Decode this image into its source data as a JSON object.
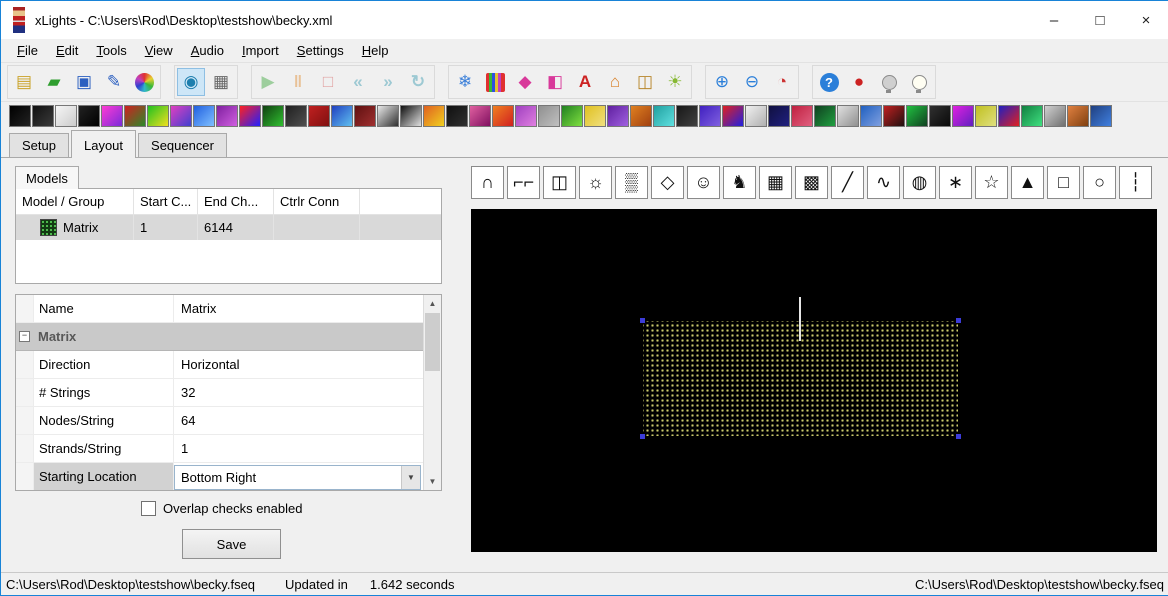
{
  "window": {
    "title": "xLights - C:\\Users\\Rod\\Desktop\\testshow\\becky.xml",
    "controls": {
      "minimize": "–",
      "maximize": "□",
      "close": "×"
    }
  },
  "menu": {
    "items": [
      "File",
      "Edit",
      "Tools",
      "View",
      "Audio",
      "Import",
      "Settings",
      "Help"
    ]
  },
  "icons": {
    "scroll_up": "▲",
    "scroll_down": "▼",
    "dropdown": "▼",
    "collapse": "−"
  },
  "toolbar": {
    "groups": [
      [
        {
          "name": "new-sequence-icon",
          "glyph": "▤",
          "fg": "#c9a227"
        },
        {
          "name": "open-sequence-icon",
          "glyph": "▰",
          "fg": "#2f9e2f"
        },
        {
          "name": "save-icon",
          "glyph": "▣",
          "fg": "#2b5fc0"
        },
        {
          "name": "save-as-icon",
          "glyph": "✎",
          "fg": "#2b5fc0"
        },
        {
          "name": "palette-icon",
          "css": "i-palette"
        }
      ],
      [
        {
          "name": "pause-render-icon",
          "glyph": "◉",
          "fg": "#1d7fae",
          "pressed": true
        },
        {
          "name": "scheduler-icon",
          "glyph": "▦",
          "fg": "#666666"
        }
      ],
      [
        {
          "name": "play-icon",
          "glyph": "▶",
          "fg": "#3aa63a",
          "disabled": true
        },
        {
          "name": "pause-icon",
          "glyph": "‖",
          "fg": "#e08a2c",
          "disabled": true,
          "bold": true
        },
        {
          "name": "stop-icon",
          "glyph": "□",
          "fg": "#d04040",
          "disabled": true,
          "bold": true
        },
        {
          "name": "rewind-icon",
          "glyph": "«",
          "fg": "#3a9ab0",
          "disabled": true,
          "bold": true
        },
        {
          "name": "go-to-end-icon",
          "glyph": "»",
          "fg": "#3a9ab0",
          "disabled": true,
          "bold": true
        },
        {
          "name": "replay-icon",
          "glyph": "↻",
          "fg": "#3a9ab0",
          "disabled": true,
          "bold": true
        }
      ],
      [
        {
          "name": "snowflake-icon",
          "glyph": "❄",
          "fg": "#3a7fd9"
        },
        {
          "name": "light-strings-icon",
          "css": "i-strings"
        },
        {
          "name": "effect-settings-icon",
          "glyph": "◆",
          "fg": "#d8399a"
        },
        {
          "name": "effect-assist-icon",
          "glyph": "◧",
          "fg": "#d8399a"
        },
        {
          "name": "font-icon",
          "glyph": "A",
          "fg": "#cc2222",
          "bold": true
        },
        {
          "name": "house-preview-icon",
          "glyph": "⌂",
          "fg": "#d9822b",
          "bold": true
        },
        {
          "name": "model-box-icon",
          "glyph": "◫",
          "fg": "#b8862b"
        },
        {
          "name": "sun-icon",
          "glyph": "☀",
          "fg": "#86b832"
        }
      ],
      [
        {
          "name": "zoom-in-icon",
          "glyph": "⊕",
          "fg": "#2b7fd9"
        },
        {
          "name": "zoom-out-icon",
          "glyph": "⊖",
          "fg": "#2b7fd9"
        },
        {
          "name": "render-all-icon",
          "glyph": "◔",
          "fg": "#cc3333"
        }
      ],
      [
        {
          "name": "help-icon",
          "css": "i-help",
          "glyph": "?"
        },
        {
          "name": "stop-now-icon",
          "glyph": "●",
          "fg": "#cc2222"
        },
        {
          "name": "lights-off-icon",
          "css": "i-bulb"
        },
        {
          "name": "lights-on-icon",
          "css": "i-bulb on"
        }
      ]
    ]
  },
  "effects_strip": {
    "icons": [
      [
        "#000000",
        "#222222"
      ],
      [
        "#111111",
        "#3a3a3a"
      ],
      [
        "#f5f5f5",
        "#cccccc"
      ],
      [
        "#222222",
        "#000000"
      ],
      [
        "#ff3bd4",
        "#7a2bd9"
      ],
      [
        "#d02020",
        "#2a8a2a"
      ],
      [
        "#20c020",
        "#f0e020"
      ],
      [
        "#e040c0",
        "#4040d0"
      ],
      [
        "#2060e0",
        "#80c0ff"
      ],
      [
        "#8020a0",
        "#d060e0"
      ],
      [
        "#ff2020",
        "#2020ff"
      ],
      [
        "#104010",
        "#30c030"
      ],
      [
        "#202020",
        "#505050"
      ],
      [
        "#c02020",
        "#801010"
      ],
      [
        "#2040c0",
        "#60c0f0"
      ],
      [
        "#601010",
        "#a03030"
      ],
      [
        "#e8e8e8",
        "#303030"
      ],
      [
        "#101010",
        "#e0e0e0"
      ],
      [
        "#e06020",
        "#f0d020"
      ],
      [
        "#101010",
        "#303030"
      ],
      [
        "#e060a0",
        "#801060"
      ],
      [
        "#f08020",
        "#d02020"
      ],
      [
        "#a040c0",
        "#e080e0"
      ],
      [
        "#909090",
        "#c0c0c0"
      ],
      [
        "#208020",
        "#80e040"
      ],
      [
        "#e0c020",
        "#f0e080"
      ],
      [
        "#6020a0",
        "#a060e0"
      ],
      [
        "#e08020",
        "#a04010"
      ],
      [
        "#20a0a0",
        "#60e0e0"
      ],
      [
        "#181818",
        "#404040"
      ],
      [
        "#4020c0",
        "#8060e0"
      ],
      [
        "#e02020",
        "#2020e0"
      ],
      [
        "#f0f0f0",
        "#b0b0b0"
      ],
      [
        "#101040",
        "#202080"
      ],
      [
        "#c02040",
        "#e06080"
      ],
      [
        "#104020",
        "#20a040"
      ],
      [
        "#e0e0e0",
        "#909090"
      ],
      [
        "#2060c0",
        "#80a0e0"
      ],
      [
        "#c02020",
        "#201010"
      ],
      [
        "#20c040",
        "#104020"
      ],
      [
        "#303030",
        "#0a0a0a"
      ],
      [
        "#e020e0",
        "#6020c0"
      ],
      [
        "#c0c020",
        "#e0e080"
      ],
      [
        "#2020c0",
        "#e02020"
      ],
      [
        "#108040",
        "#40e080"
      ],
      [
        "#d0d0d0",
        "#707070"
      ],
      [
        "#e08040",
        "#804010"
      ],
      [
        "#204080",
        "#4080e0"
      ]
    ]
  },
  "tabs": {
    "items": [
      "Setup",
      "Layout",
      "Sequencer"
    ],
    "active": "Layout"
  },
  "models_panel": {
    "title": "Models",
    "columns": [
      "Model / Group",
      "Start C...",
      "End Ch...",
      "Ctrlr Conn"
    ],
    "rows": [
      {
        "name": "Matrix",
        "start": "1",
        "end": "6144",
        "ctrlr": ""
      }
    ]
  },
  "properties": {
    "rows": [
      {
        "label": "Name",
        "value": "Matrix",
        "kind": "text"
      },
      {
        "label": "Matrix",
        "value": "",
        "kind": "category"
      },
      {
        "label": "Direction",
        "value": "Horizontal",
        "kind": "text"
      },
      {
        "label": "# Strings",
        "value": "32",
        "kind": "text"
      },
      {
        "label": "Nodes/String",
        "value": "64",
        "kind": "text"
      },
      {
        "label": "Strands/String",
        "value": "1",
        "kind": "text"
      },
      {
        "label": "Starting Location",
        "value": "Bottom Right",
        "kind": "dropdown",
        "label_selected": true
      }
    ]
  },
  "overlap_checkbox": {
    "label": "Overlap checks enabled",
    "checked": false
  },
  "save_button": {
    "label": "Save"
  },
  "model_tools": {
    "items": [
      {
        "name": "arch-icon",
        "glyph": "∩"
      },
      {
        "name": "candy-cane-icon",
        "glyph": "⌐⌐"
      },
      {
        "name": "window-frame-icon",
        "glyph": "◫"
      },
      {
        "name": "circle-icon",
        "glyph": "☼"
      },
      {
        "name": "matrix-icon",
        "glyph": "▒"
      },
      {
        "name": "wreath-icon",
        "glyph": "◇"
      },
      {
        "name": "singing-face-icon",
        "glyph": "☺"
      },
      {
        "name": "reindeer-icon",
        "glyph": "♞"
      },
      {
        "name": "dense-matrix-icon",
        "glyph": "▦"
      },
      {
        "name": "panel-matrix-icon",
        "glyph": "▩"
      },
      {
        "name": "line-icon",
        "glyph": "╱"
      },
      {
        "name": "poly-line-icon",
        "glyph": "∿"
      },
      {
        "name": "sphere-icon",
        "glyph": "◍"
      },
      {
        "name": "spinner-icon",
        "glyph": "∗"
      },
      {
        "name": "star-icon",
        "glyph": "☆"
      },
      {
        "name": "tree-icon",
        "glyph": "▲"
      },
      {
        "name": "frame-icon",
        "glyph": "□"
      },
      {
        "name": "circle-model-icon",
        "glyph": "○"
      },
      {
        "name": "icicles-icon",
        "glyph": "┆"
      }
    ]
  },
  "statusbar": {
    "left": "C:\\Users\\Rod\\Desktop\\testshow\\becky.fseq",
    "updated_label": "Updated in",
    "updated_value": "1.642 seconds",
    "right": "C:\\Users\\Rod\\Desktop\\testshow\\becky.fseq"
  }
}
